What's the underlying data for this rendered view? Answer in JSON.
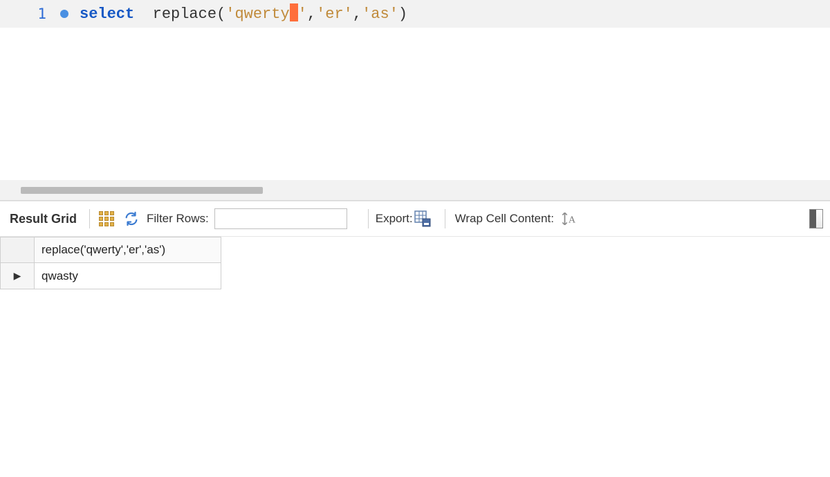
{
  "editor": {
    "line_number": "1",
    "tokens": {
      "kw_select": "select",
      "fn_replace": "replace",
      "str1": "'qwerty",
      "str1_close": "'",
      "str2": "'er'",
      "str3": "'as'"
    }
  },
  "toolbar": {
    "result_grid_label": "Result Grid",
    "filter_label": "Filter Rows:",
    "filter_value": "",
    "filter_placeholder": "",
    "export_label": "Export:",
    "wrap_label": "Wrap Cell Content:"
  },
  "grid": {
    "columns": [
      "replace('qwerty','er','as')"
    ],
    "rows": [
      {
        "cells": [
          "qwasty"
        ]
      }
    ]
  }
}
